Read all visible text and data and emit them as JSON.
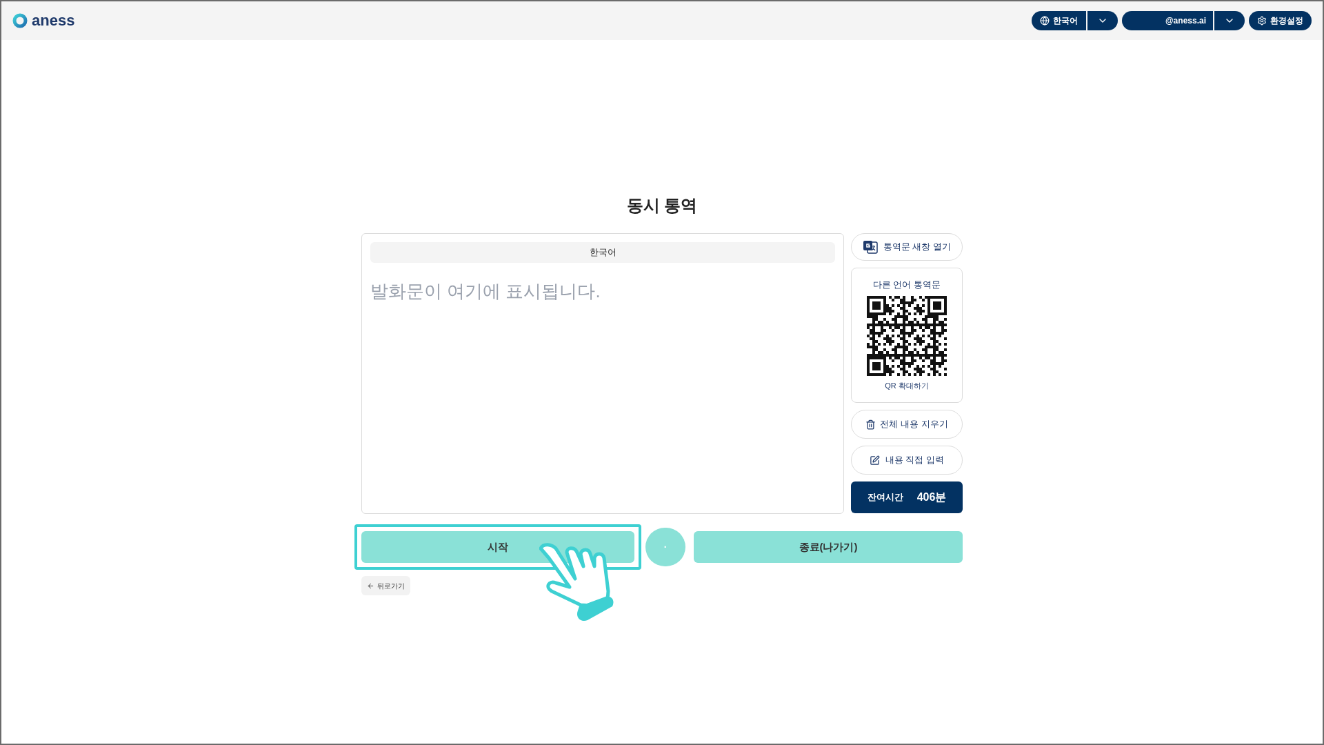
{
  "header": {
    "logo": "aness",
    "language_button": "한국어",
    "account_button": "@aness.ai",
    "settings_button": "환경설정"
  },
  "title": "동시 통역",
  "transcript": {
    "language": "한국어",
    "placeholder": "발화문이 여기에 표시됩니다."
  },
  "side": {
    "open_window_button": "통역문 새창 열기",
    "qr_card": {
      "title": "다른 언어 통역문",
      "link": "QR 확대하기"
    },
    "clear_button": "전체 내용 지우기",
    "manual_input_button": "내용 직접 입력",
    "remaining": {
      "label": "잔여시간",
      "value": "406분"
    }
  },
  "controls": {
    "start_button": {
      "label": "시작",
      "highlighted": true
    },
    "indicator": "·",
    "end_button": "종료(나가기)"
  },
  "back_button": "뒤로가기"
}
